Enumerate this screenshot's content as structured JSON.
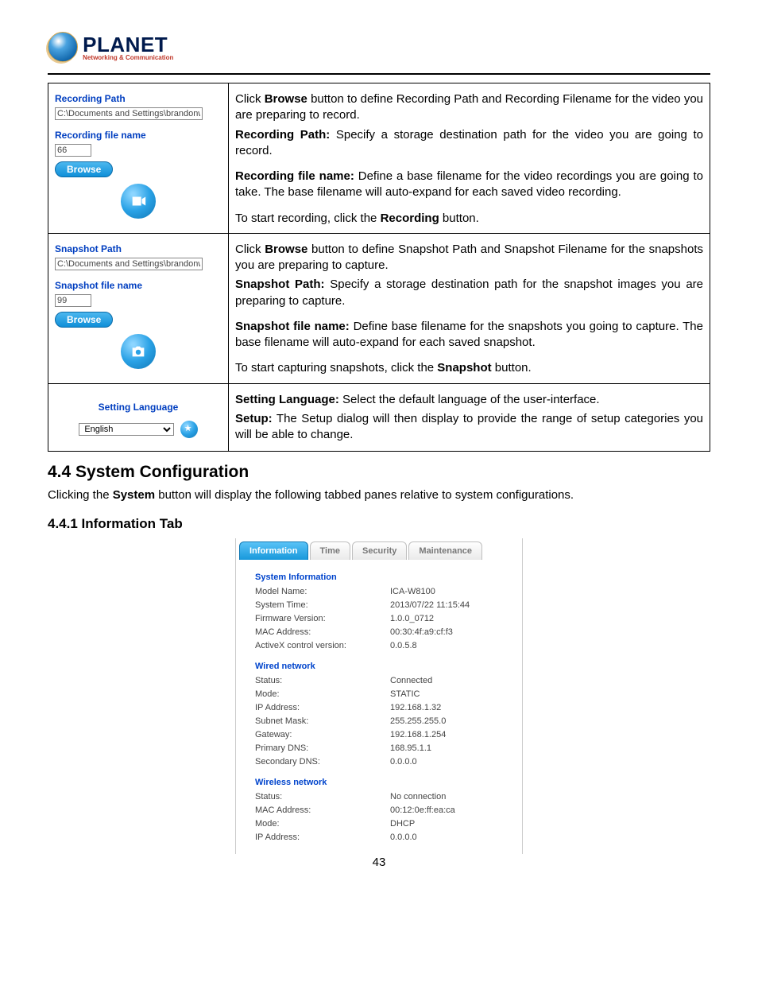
{
  "brand": {
    "name": "PLANET",
    "sub": "Networking & Communication"
  },
  "table": {
    "row1": {
      "label_path": "Recording Path",
      "input_path": "C:\\Documents and Settings\\brandonw",
      "label_file": "Recording file name",
      "input_file": "66",
      "browse": "Browse",
      "p1a": "Click ",
      "p1b": "Browse",
      "p1c": " button to define Recording Path and Recording Filename for the video you are preparing to record.",
      "p2a": "Recording Path:",
      "p2b": " Specify a storage destination path for the video you are going to record.",
      "p3a": "Recording file name:",
      "p3b": " Define a base filename for the video recordings you are going to take. The base filename will auto-expand for each saved video recording.",
      "p4a": "To start recording, click the ",
      "p4b": "Recording",
      "p4c": " button."
    },
    "row2": {
      "label_path": "Snapshot Path",
      "input_path": "C:\\Documents and Settings\\brandonw",
      "label_file": "Snapshot file name",
      "input_file": "99",
      "browse": "Browse",
      "p1a": "Click ",
      "p1b": "Browse",
      "p1c": " button to define Snapshot Path and Snapshot Filename for the snapshots you are preparing to capture.",
      "p2a": "Snapshot Path:",
      "p2b": " Specify a storage destination path for the snapshot images you are preparing to capture.",
      "p3a": "Snapshot file name:",
      "p3b": " Define base filename for the snapshots you going to capture. The base filename will auto-expand for each saved snapshot.",
      "p4a": "To start capturing snapshots, click the ",
      "p4b": "Snapshot",
      "p4c": " button."
    },
    "row3": {
      "label": "Setting Language",
      "select": "English",
      "p1a": "Setting Language:",
      "p1b": " Select the default language of the user-interface.",
      "p2a": "Setup:",
      "p2b": " The Setup dialog will then display to provide the range of setup categories you will be able to change."
    }
  },
  "section_heading": "4.4 System Configuration",
  "section_text_a": "Clicking the ",
  "section_text_b": "System",
  "section_text_c": " button will display the following tabbed panes relative to system configurations.",
  "subsection_heading": "4.4.1 Information Tab",
  "tabs": {
    "t1": "Information",
    "t2": "Time",
    "t3": "Security",
    "t4": "Maintenance"
  },
  "info": {
    "h1": "System Information",
    "r1k": "Model Name:",
    "r1v": "ICA-W8100",
    "r2k": "System Time:",
    "r2v": "2013/07/22 11:15:44",
    "r3k": "Firmware Version:",
    "r3v": "1.0.0_0712",
    "r4k": "MAC Address:",
    "r4v": "00:30:4f:a9:cf:f3",
    "r5k": "ActiveX control version:",
    "r5v": "0.0.5.8",
    "h2": "Wired network",
    "r6k": "Status:",
    "r6v": "Connected",
    "r7k": "Mode:",
    "r7v": "STATIC",
    "r8k": "IP Address:",
    "r8v": "192.168.1.32",
    "r9k": "Subnet Mask:",
    "r9v": "255.255.255.0",
    "r10k": "Gateway:",
    "r10v": "192.168.1.254",
    "r11k": "Primary DNS:",
    "r11v": "168.95.1.1",
    "r12k": "Secondary DNS:",
    "r12v": "0.0.0.0",
    "h3": "Wireless network",
    "r13k": "Status:",
    "r13v": "No connection",
    "r14k": "MAC Address:",
    "r14v": "00:12:0e:ff:ea:ca",
    "r15k": "Mode:",
    "r15v": "DHCP",
    "r16k": "IP Address:",
    "r16v": "0.0.0.0"
  },
  "page_number": "43"
}
